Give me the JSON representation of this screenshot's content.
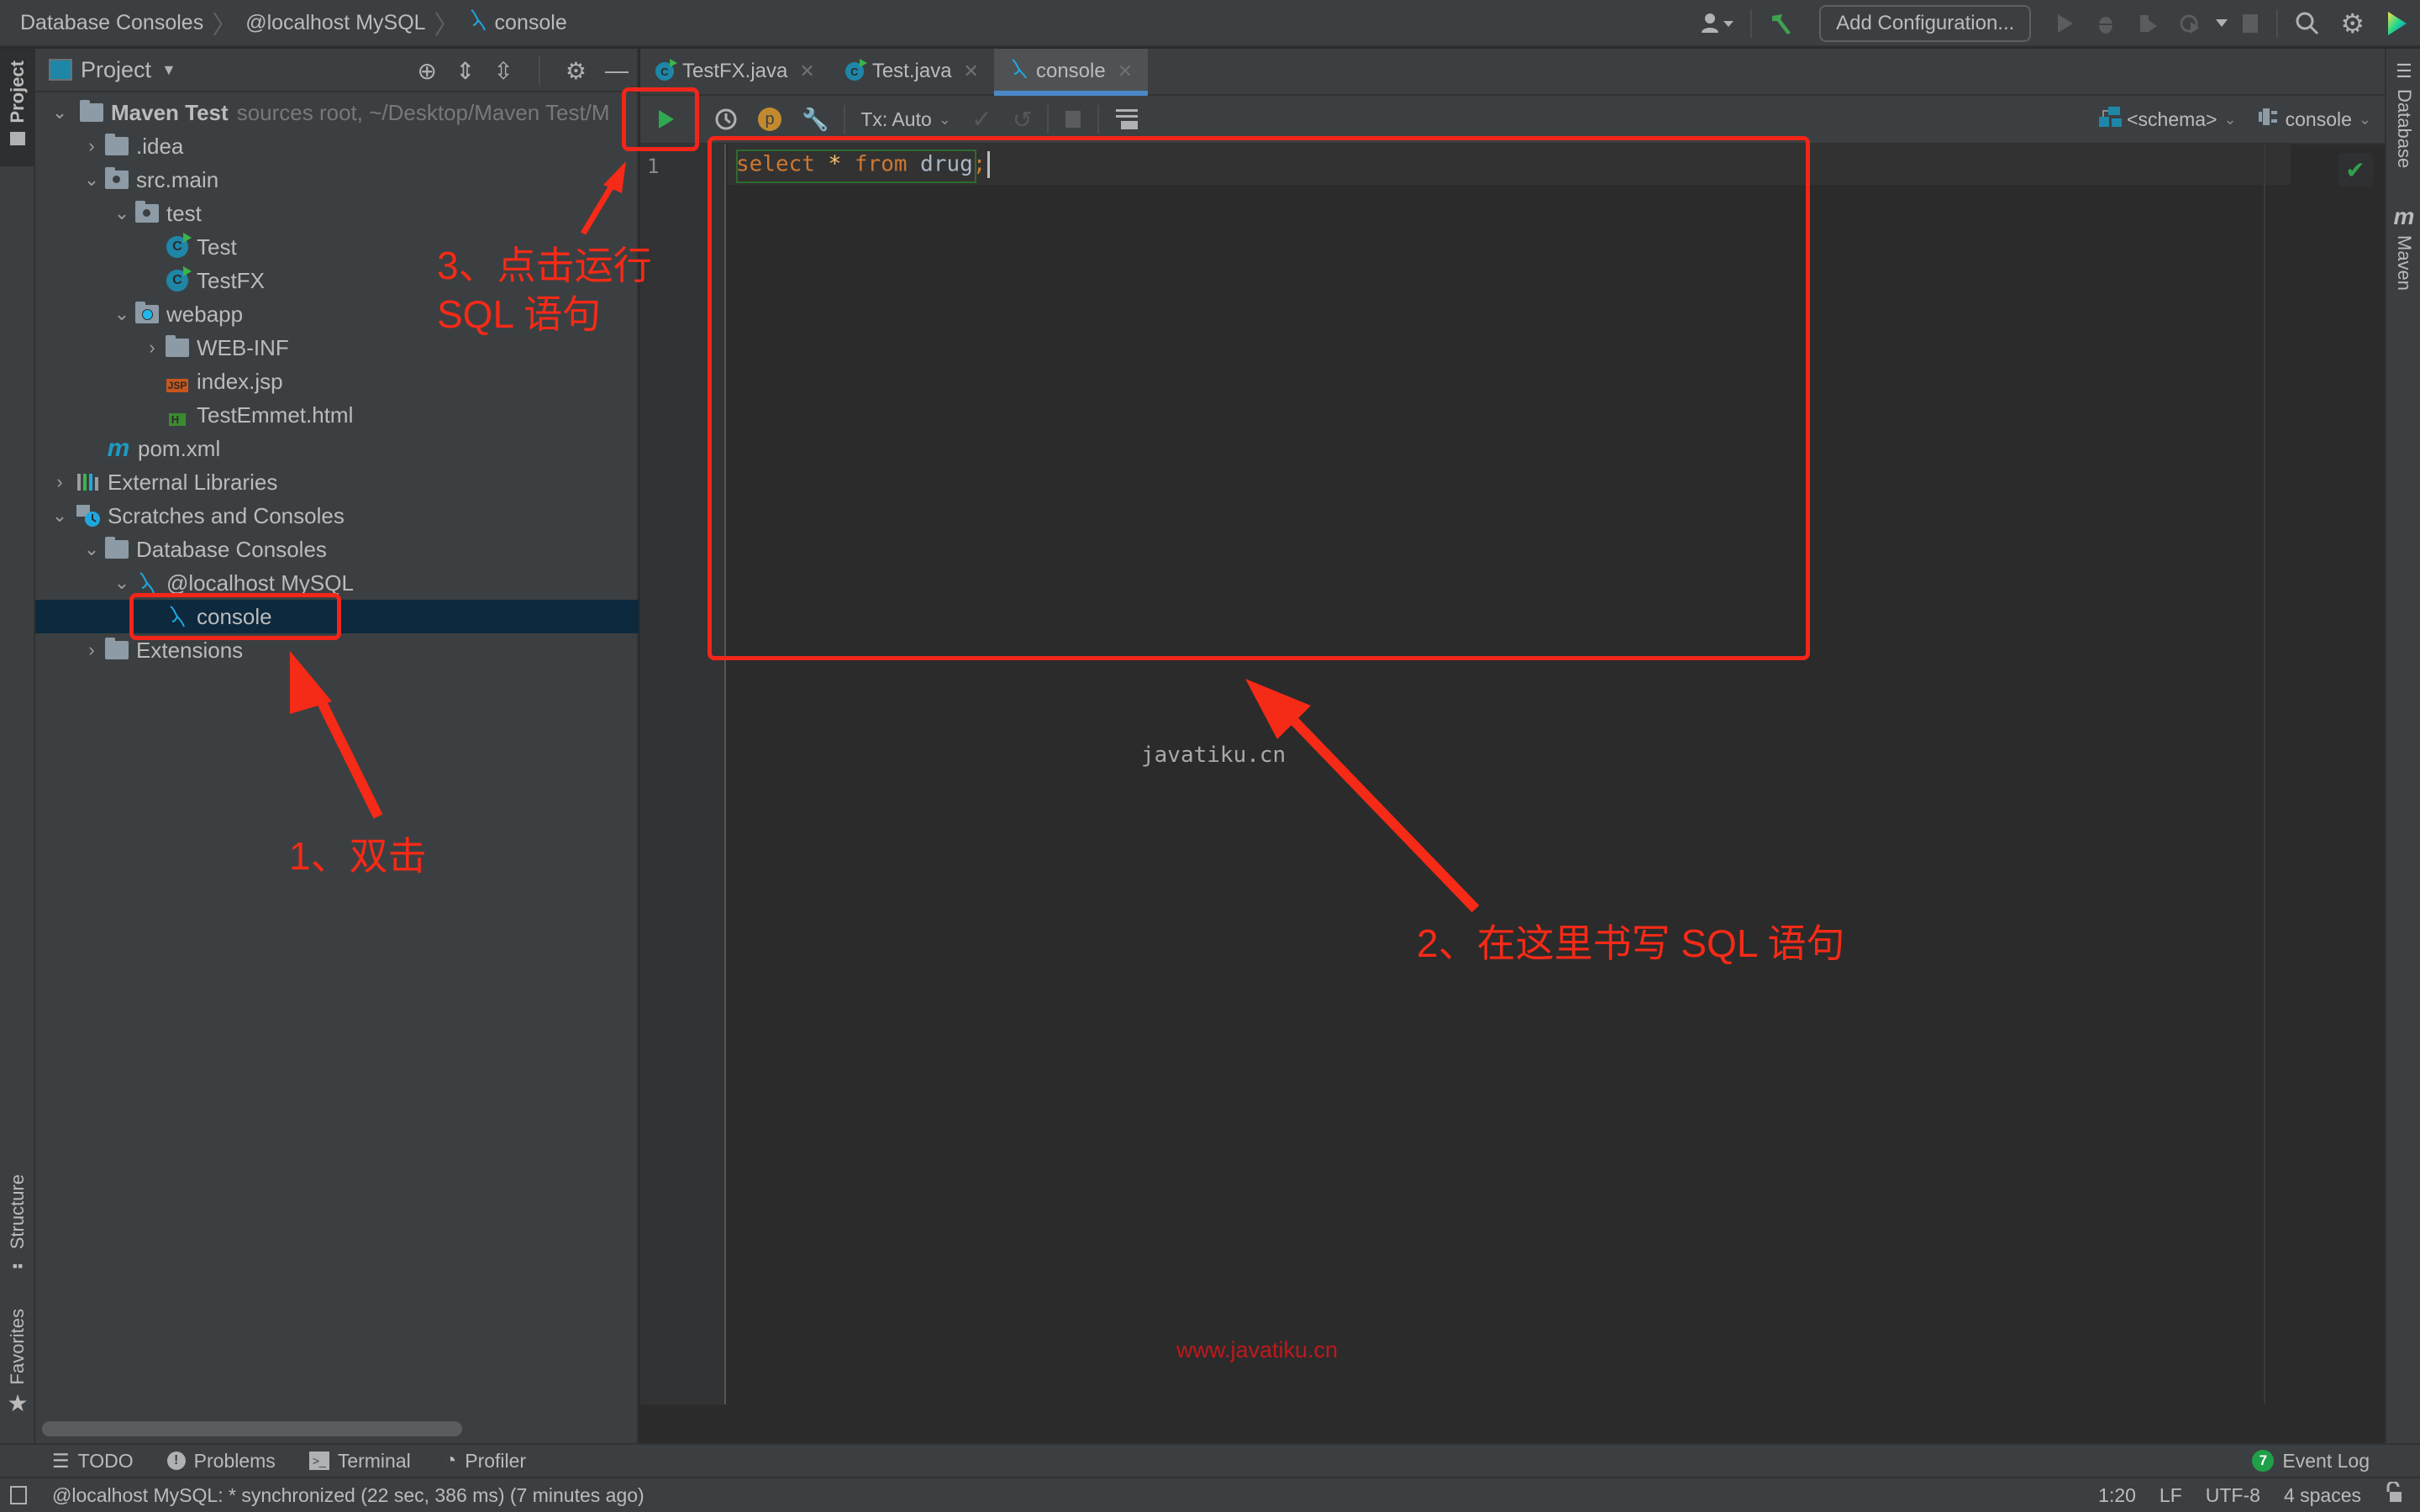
{
  "navbar": {
    "breadcrumbs": [
      "Database Consoles",
      "@localhost MySQL",
      "console"
    ],
    "add_configuration": "Add Configuration..."
  },
  "left_strip": {
    "tabs": [
      "Project",
      "Structure",
      "Favorites"
    ]
  },
  "right_strip": {
    "tabs": [
      "Database",
      "Maven"
    ]
  },
  "project": {
    "title": "Project",
    "tree": [
      {
        "label": "Maven Test",
        "hint": "sources root, ~/Desktop/Maven Test/M",
        "icon": "module-icon",
        "expanded": true
      },
      {
        "label": ".idea",
        "icon": "folder-icon",
        "expanded": false
      },
      {
        "label": "src.main",
        "icon": "source-folder-icon",
        "expanded": true
      },
      {
        "label": "test",
        "icon": "source-folder-icon",
        "expanded": true
      },
      {
        "label": "Test",
        "icon": "java-class-icon"
      },
      {
        "label": "TestFX",
        "icon": "java-class-icon"
      },
      {
        "label": "webapp",
        "icon": "web-folder-icon",
        "expanded": true
      },
      {
        "label": "WEB-INF",
        "icon": "folder-icon",
        "expanded": false
      },
      {
        "label": "index.jsp",
        "icon": "jsp-file-icon"
      },
      {
        "label": "TestEmmet.html",
        "icon": "html-file-icon"
      },
      {
        "label": "pom.xml",
        "icon": "maven-icon"
      },
      {
        "label": "External Libraries",
        "icon": "libraries-icon",
        "expanded": false
      },
      {
        "label": "Scratches and Consoles",
        "icon": "scratches-icon",
        "expanded": true
      },
      {
        "label": "Database Consoles",
        "icon": "folder-icon",
        "expanded": true
      },
      {
        "label": "@localhost MySQL",
        "icon": "mysql-icon",
        "expanded": true
      },
      {
        "label": "console",
        "icon": "mysql-icon",
        "selected": true
      },
      {
        "label": "Extensions",
        "icon": "folder-icon",
        "expanded": false
      }
    ]
  },
  "tabs": [
    {
      "label": "TestFX.java",
      "active": false
    },
    {
      "label": "Test.java",
      "active": false
    },
    {
      "label": "console",
      "active": true
    }
  ],
  "toolbar": {
    "tx_mode": "Tx: Auto",
    "schema": "<schema>",
    "session": "console"
  },
  "editor": {
    "line_number": "1",
    "code": {
      "kw1": "select",
      "star": "*",
      "kw2": "from",
      "table": "drug",
      "semi": ";"
    }
  },
  "watermarks": {
    "center": "javatiku.cn",
    "bottom": "www.javatiku.cn"
  },
  "bottom_tools": {
    "items": [
      "TODO",
      "Problems",
      "Terminal",
      "Profiler"
    ],
    "event_log": "Event Log",
    "event_count": "7"
  },
  "status": {
    "message": "@localhost MySQL: * synchronized (22 sec, 386 ms) (7 minutes ago)",
    "position": "1:20",
    "line_sep": "LF",
    "encoding": "UTF-8",
    "indent": "4 spaces"
  },
  "annotations": {
    "step1": "1、双击",
    "step2": "2、在这里书写 SQL 语句",
    "step3_line1": "3、点击运行",
    "step3_line2": "SQL 语句"
  },
  "colors": {
    "accent": "#4a88c7",
    "annotation": "#f52a17",
    "keyword": "#cc7832",
    "selection": "#0d293e"
  }
}
